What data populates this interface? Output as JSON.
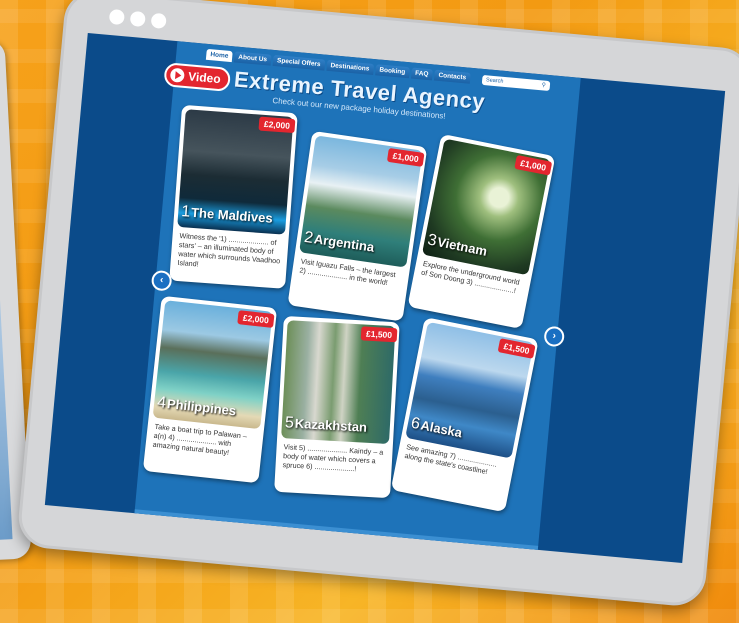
{
  "nav": {
    "items": [
      "Home",
      "About Us",
      "Special Offers",
      "Destinations",
      "Booking",
      "FAQ",
      "Contacts"
    ],
    "search_label": "Search",
    "search_icon": "magnifier-icon"
  },
  "header": {
    "video_label": "Video",
    "title": "Extreme Travel Agency",
    "subtitle": "Check out our new package holiday destinations!"
  },
  "cards": [
    {
      "price": "£2,000",
      "number": "1",
      "name": "The Maldives",
      "description": "Witness the '1) .................... of stars' – an illuminated body of water which surrounds Vaadhoo Island!"
    },
    {
      "price": "£1,000",
      "number": "2",
      "name": "Argentina",
      "description": "Visit Iguazu Falls – the largest 2) .................... in the world!"
    },
    {
      "price": "£1,000",
      "number": "3",
      "name": "Vietnam",
      "description": "Explore the underground world of Son Doong 3) ....................!"
    },
    {
      "price": "£2,000",
      "number": "4",
      "name": "Philippines",
      "description": "Take a boat trip to Palawan – a(n) 4) .................... with amazing natural beauty!"
    },
    {
      "price": "£1,500",
      "number": "5",
      "name": "Kazakhstan",
      "description": "Visit 5) .................... Kaindy – a body of water which covers a spruce 6) ....................!"
    },
    {
      "price": "£1,500",
      "number": "6",
      "name": "Alaska",
      "description": "See amazing 7) .................... along the state's coastline!"
    }
  ],
  "arrows": {
    "prev": "‹",
    "next": "›"
  }
}
